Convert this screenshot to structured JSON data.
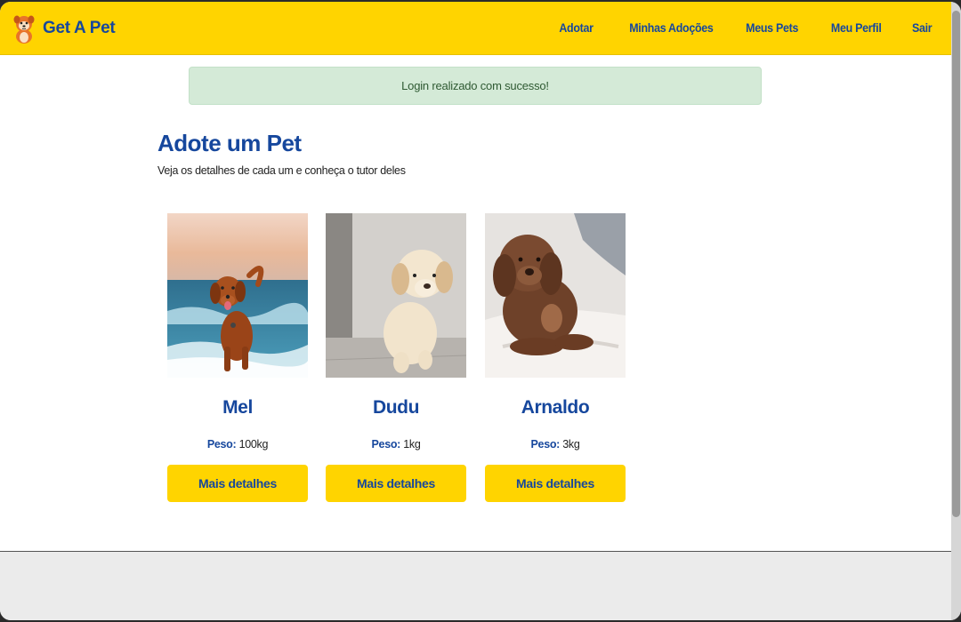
{
  "brand": {
    "name": "Get A Pet",
    "logo_icon": "pet-mascot-logo"
  },
  "nav": {
    "links": [
      "Adotar",
      "Minhas Adoções",
      "Meus Pets",
      "Meu Perfil",
      "Sair"
    ]
  },
  "alert": {
    "message": "Login realizado com sucesso!"
  },
  "main": {
    "title": "Adote um Pet",
    "subtitle": "Veja os detalhes de cada um e conheça o tutor deles"
  },
  "pets": [
    {
      "name": "Mel",
      "weight_label": "Peso:",
      "weight": "100kg",
      "button": "Mais detalhes",
      "photo": "dog-running-beach"
    },
    {
      "name": "Dudu",
      "weight_label": "Peso:",
      "weight": "1kg",
      "button": "Mais detalhes",
      "photo": "labrador-puppy"
    },
    {
      "name": "Arnaldo",
      "weight_label": "Peso:",
      "weight": "3kg",
      "button": "Mais detalhes",
      "photo": "curly-brown-dog"
    }
  ],
  "colors": {
    "primary_yellow": "#ffd400",
    "primary_blue": "#16479d",
    "alert_bg": "#d4ead7",
    "footer_bg": "#ebebeb"
  }
}
